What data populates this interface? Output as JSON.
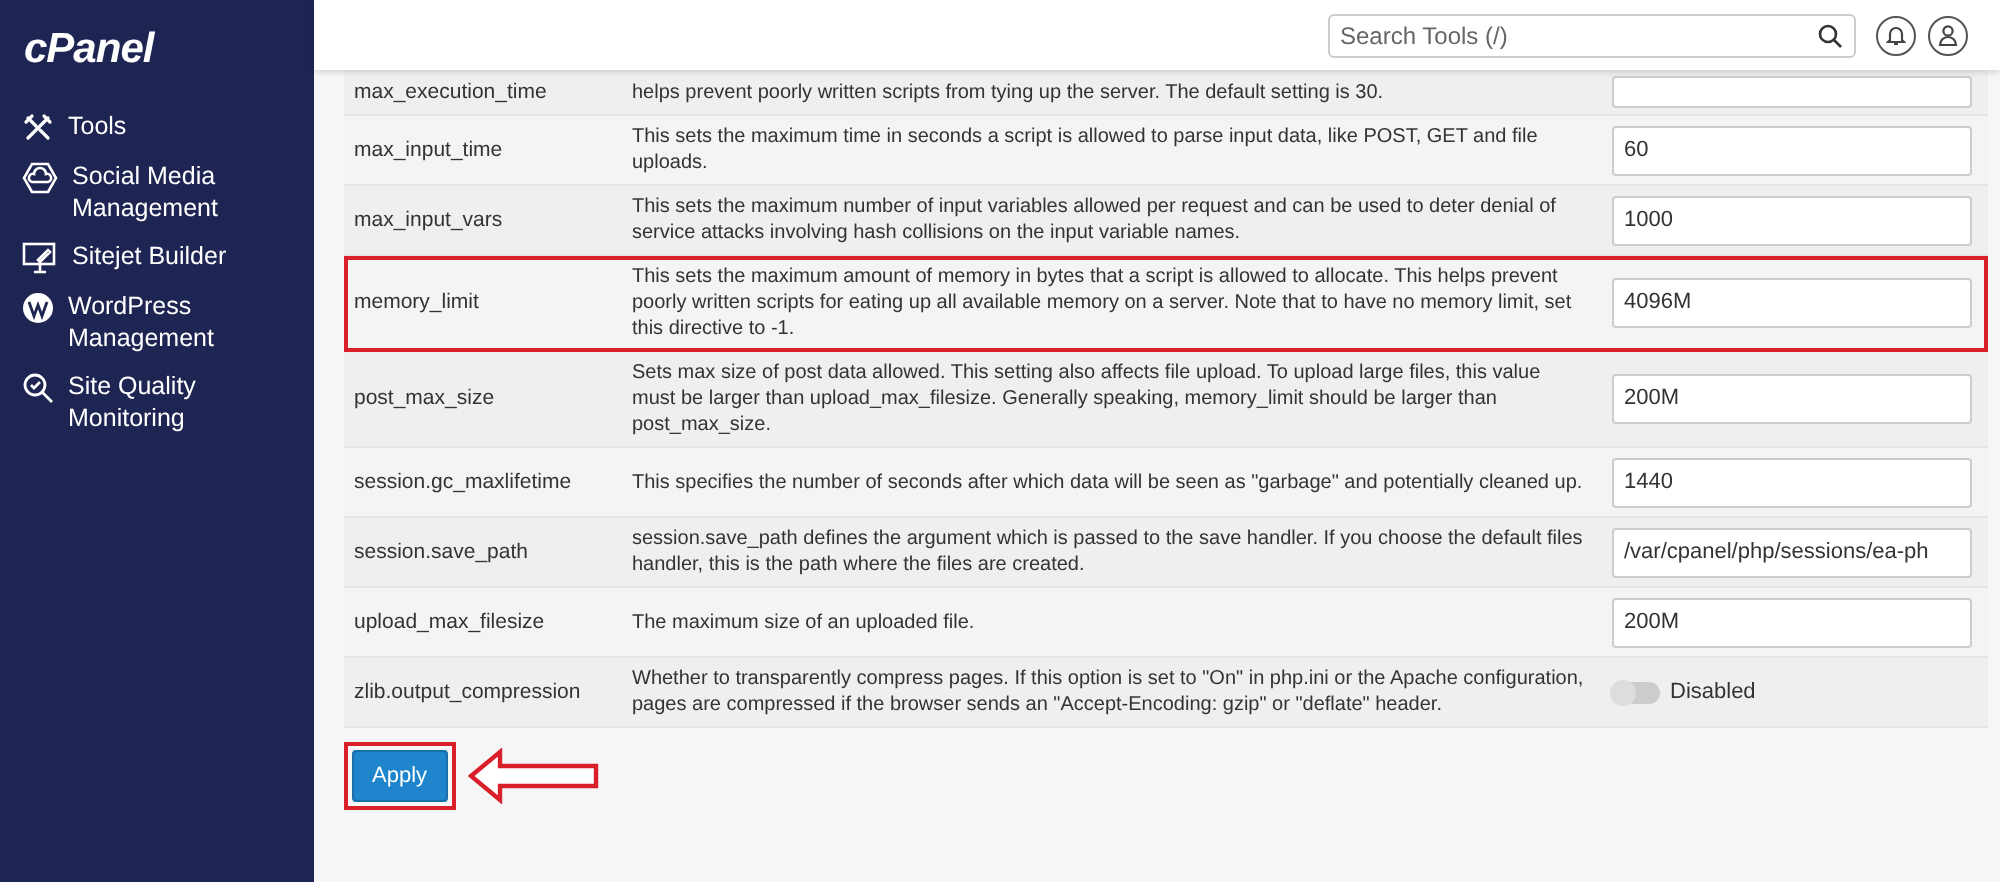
{
  "sidebar": {
    "logo": "cPanel",
    "items": [
      {
        "label": "Tools"
      },
      {
        "label": "Social Media Management"
      },
      {
        "label": "Sitejet Builder"
      },
      {
        "label": "WordPress Management"
      },
      {
        "label": "Site Quality Monitoring"
      }
    ]
  },
  "topbar": {
    "search": {
      "placeholder": "Search Tools (/)"
    }
  },
  "settings": {
    "rows": [
      {
        "name": "max_execution_time",
        "description": "helps prevent poorly written scripts from tying up the server. The default setting is 30.",
        "kind": "text",
        "highlighted": false
      },
      {
        "name": "max_input_time",
        "description": "This sets the maximum time in seconds a script is allowed to parse input data, like POST, GET and file uploads.",
        "kind": "text",
        "value": "60",
        "highlighted": false
      },
      {
        "name": "max_input_vars",
        "description": "This sets the maximum number of input variables allowed per request and can be used to deter denial of service attacks involving hash collisions on the input variable names.",
        "kind": "text",
        "value": "1000",
        "highlighted": false
      },
      {
        "name": "memory_limit",
        "description": "This sets the maximum amount of memory in bytes that a script is allowed to allocate. This helps prevent poorly written scripts for eating up all available memory on a server. Note that to have no memory limit, set this directive to -1.",
        "kind": "text",
        "value": "4096M",
        "highlighted": true
      },
      {
        "name": "post_max_size",
        "description": "Sets max size of post data allowed. This setting also affects file upload. To upload large files, this value must be larger than upload_max_filesize. Generally speaking, memory_limit should be larger than post_max_size.",
        "kind": "text",
        "value": "200M",
        "highlighted": false
      },
      {
        "name": "session.gc_maxlifetime",
        "description": "This specifies the number of seconds after which data will be seen as \"garbage\" and potentially cleaned up.",
        "kind": "text",
        "value": "1440",
        "highlighted": false
      },
      {
        "name": "session.save_path",
        "description": "session.save_path defines the argument which is passed to the save handler. If you choose the default files handler, this is the path where the files are created.",
        "kind": "text",
        "value": "/var/cpanel/php/sessions/ea-ph",
        "highlighted": false
      },
      {
        "name": "upload_max_filesize",
        "description": "The maximum size of an uploaded file.",
        "kind": "text",
        "value": "200M",
        "highlighted": false
      },
      {
        "name": "zlib.output_compression",
        "description": "Whether to transparently compress pages. If this option is set to \"On\" in php.ini or the Apache configuration, pages are compressed if the browser sends an \"Accept-Encoding: gzip\" or \"deflate\" header.",
        "kind": "toggle",
        "on": false,
        "state_label": "Disabled",
        "highlighted": false
      }
    ],
    "apply": {
      "label": "Apply",
      "highlighted": true,
      "arrow": true
    }
  }
}
